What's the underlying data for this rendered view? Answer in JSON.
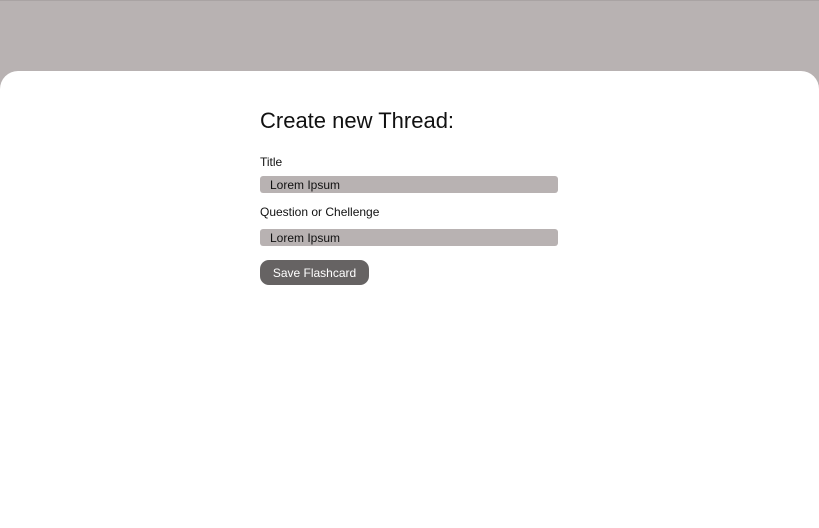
{
  "form": {
    "heading": "Create new Thread:",
    "title_label": "Title",
    "title_value": "Lorem Ipsum",
    "question_label": "Question or Chellenge",
    "question_value": "Lorem Ipsum",
    "save_label": "Save Flashcard"
  },
  "colors": {
    "background": "#b8b2b2",
    "card": "#ffffff",
    "input_fill": "#b8b2b2",
    "button": "#666363",
    "button_text": "#ffffff"
  }
}
